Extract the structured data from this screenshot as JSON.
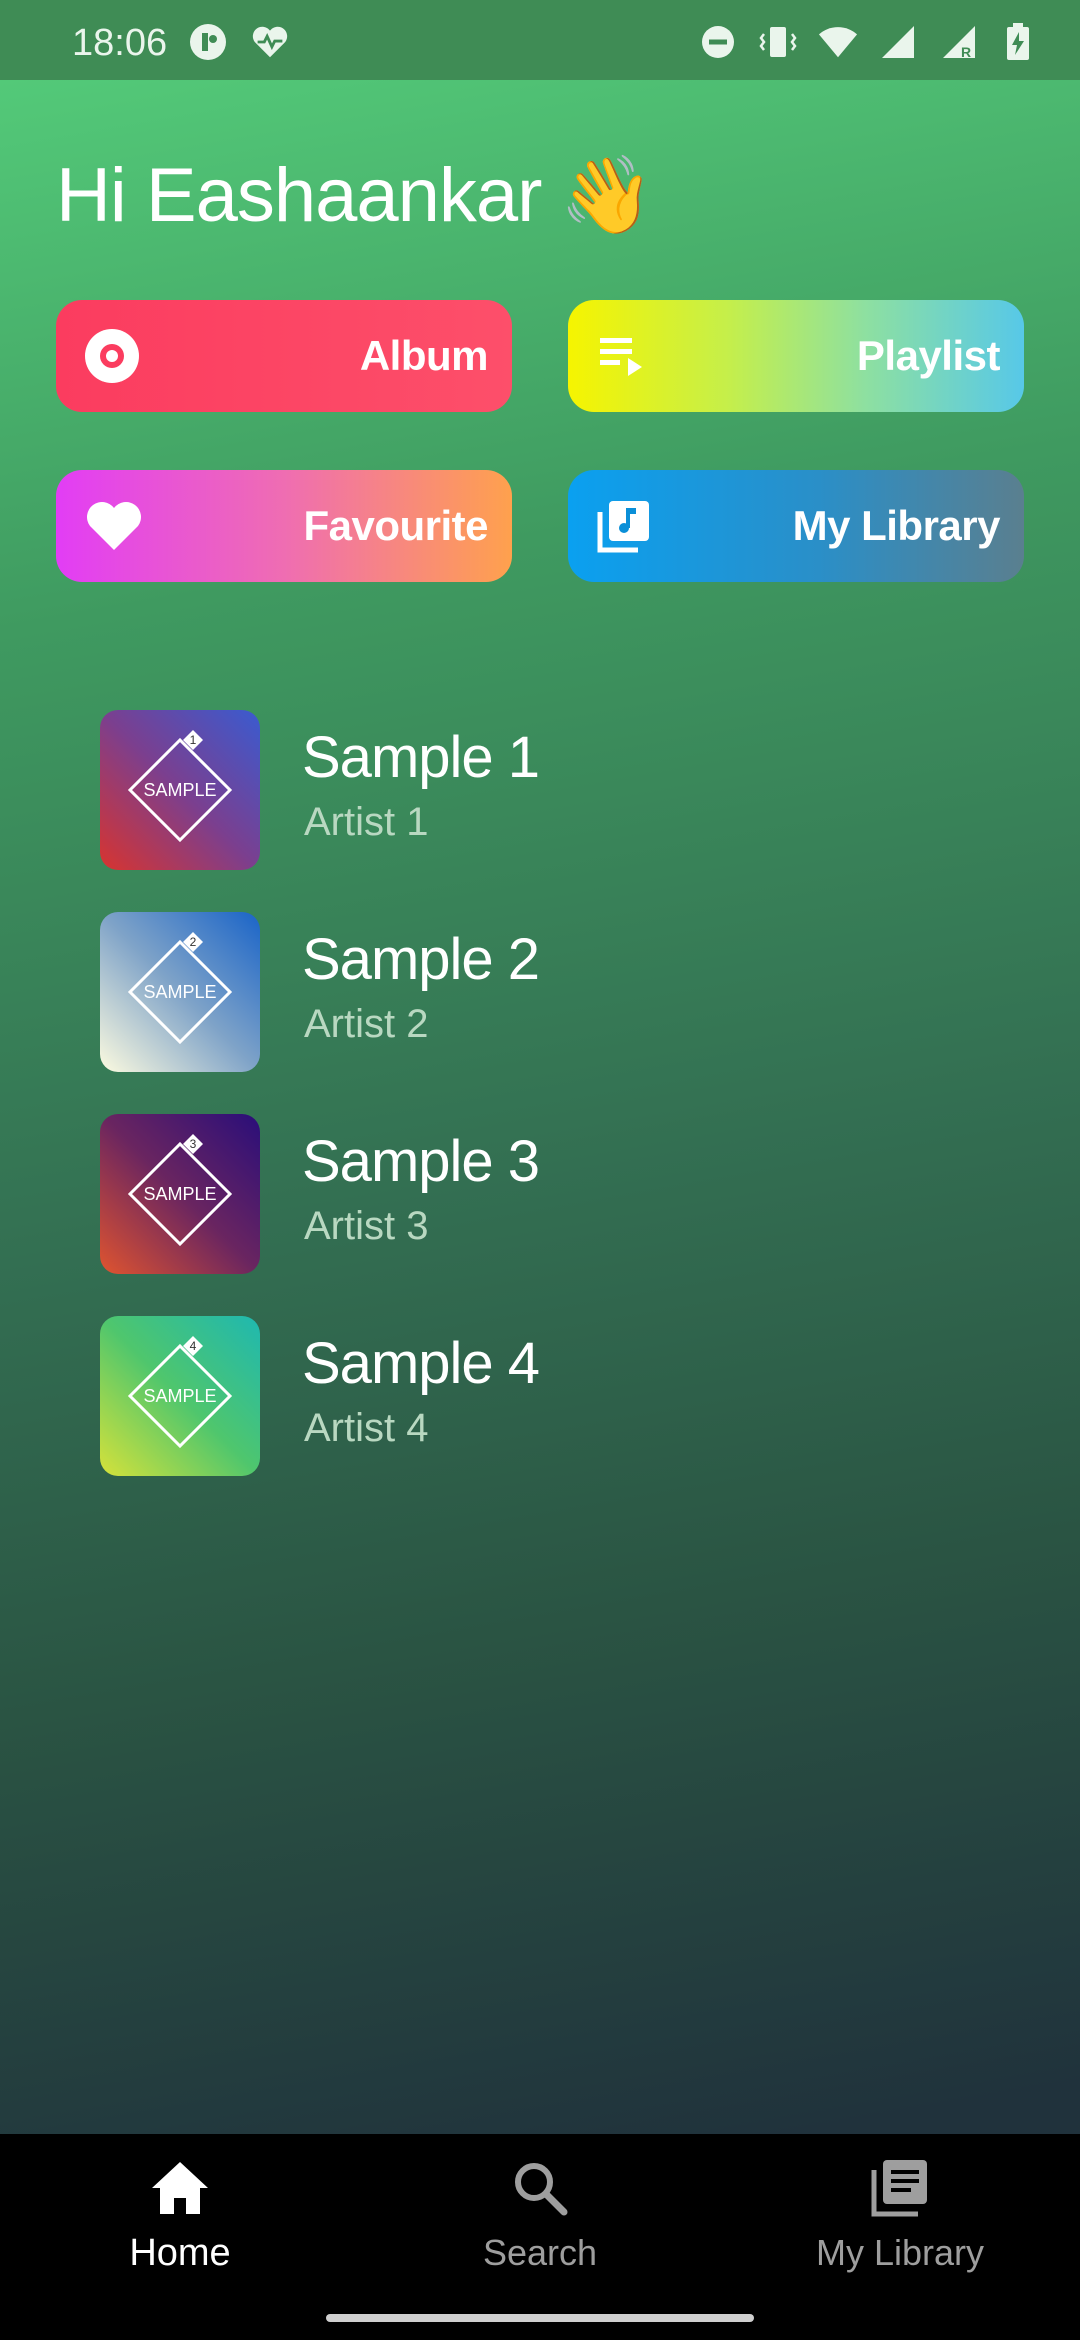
{
  "status_bar": {
    "time": "18:06",
    "left_icons": [
      "app-notification-icon",
      "heart-pulse-icon"
    ],
    "right_icons": [
      "do-not-disturb-icon",
      "vibrate-icon",
      "wifi-icon",
      "signal-icon",
      "signal-roaming-icon",
      "battery-charging-icon"
    ]
  },
  "greeting": {
    "text": "Hi Eashaankar",
    "emoji": "👋"
  },
  "quick_tiles": [
    {
      "label": "Album",
      "icon": "disc-icon"
    },
    {
      "label": "Playlist",
      "icon": "playlist-play-icon"
    },
    {
      "label": "Favourite",
      "icon": "heart-icon"
    },
    {
      "label": "My Library",
      "icon": "library-music-icon"
    }
  ],
  "tracks": [
    {
      "title": "Sample 1",
      "artist": "Artist 1",
      "cover_text": "SAMPLE",
      "cover_number": "1",
      "colors": [
        "#3a5bd0",
        "#7b3f8f",
        "#d8342f"
      ]
    },
    {
      "title": "Sample 2",
      "artist": "Artist 2",
      "cover_text": "SAMPLE",
      "cover_number": "2",
      "colors": [
        "#1a64c8",
        "#7fa3c8",
        "#fdfbe0"
      ]
    },
    {
      "title": "Sample 3",
      "artist": "Artist 3",
      "cover_text": "SAMPLE",
      "cover_number": "3",
      "colors": [
        "#2a0e7a",
        "#6a2560",
        "#e0542f"
      ]
    },
    {
      "title": "Sample 4",
      "artist": "Artist 4",
      "cover_text": "SAMPLE",
      "cover_number": "4",
      "colors": [
        "#1fb8b0",
        "#4fc66d",
        "#d6e23a"
      ]
    }
  ],
  "bottom_nav": [
    {
      "label": "Home",
      "icon": "home-icon",
      "active": true
    },
    {
      "label": "Search",
      "icon": "search-icon",
      "active": false
    },
    {
      "label": "My Library",
      "icon": "library-books-icon",
      "active": false
    }
  ],
  "colors": {
    "accent_album": "#fb3c5f",
    "accent_playlist": "#f6f400",
    "accent_favourite": "#e23df5",
    "accent_library": "#0aa0f0",
    "nav_background": "#000000",
    "nav_active": "#ffffff",
    "nav_inactive": "#9e9e9e"
  }
}
